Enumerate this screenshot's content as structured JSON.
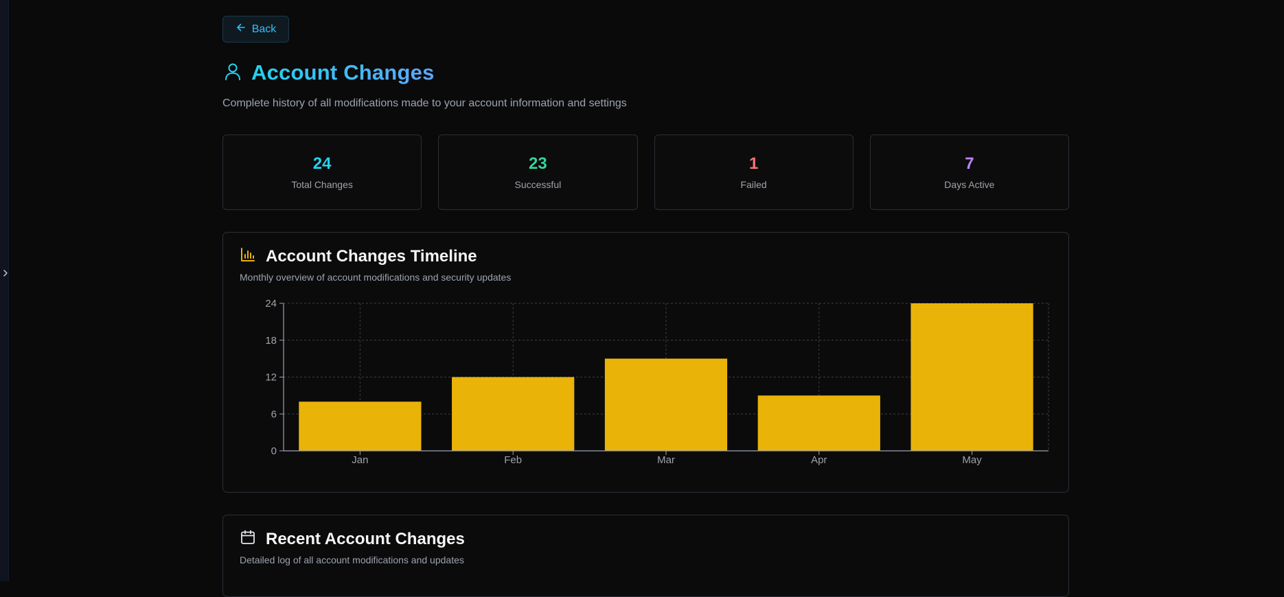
{
  "nav": {
    "back_label": "Back",
    "sidebar_toggle_icon": "chevron-right-icon"
  },
  "header": {
    "icon": "user-icon",
    "title": "Account Changes",
    "subtitle": "Complete history of all modifications made to your account information and settings"
  },
  "stats": [
    {
      "value": "24",
      "label": "Total Changes",
      "color": "#22d3ee"
    },
    {
      "value": "23",
      "label": "Successful",
      "color": "#34d399"
    },
    {
      "value": "1",
      "label": "Failed",
      "color": "#f87171"
    },
    {
      "value": "7",
      "label": "Days Active",
      "color": "#c084fc"
    }
  ],
  "timeline": {
    "icon": "bar-chart-icon",
    "title": "Account Changes Timeline",
    "description": "Monthly overview of account modifications and security updates"
  },
  "chart_data": {
    "type": "bar",
    "categories": [
      "Jan",
      "Feb",
      "Mar",
      "Apr",
      "May"
    ],
    "values": [
      8,
      12,
      15,
      9,
      24
    ],
    "title": "",
    "xlabel": "",
    "ylabel": "",
    "ylim": [
      0,
      24
    ],
    "yticks": [
      0,
      6,
      12,
      18,
      24
    ],
    "grid": true,
    "bar_color": "#eab308"
  },
  "recent": {
    "icon": "calendar-icon",
    "title": "Recent Account Changes",
    "description": "Detailed log of all account modifications and updates"
  }
}
